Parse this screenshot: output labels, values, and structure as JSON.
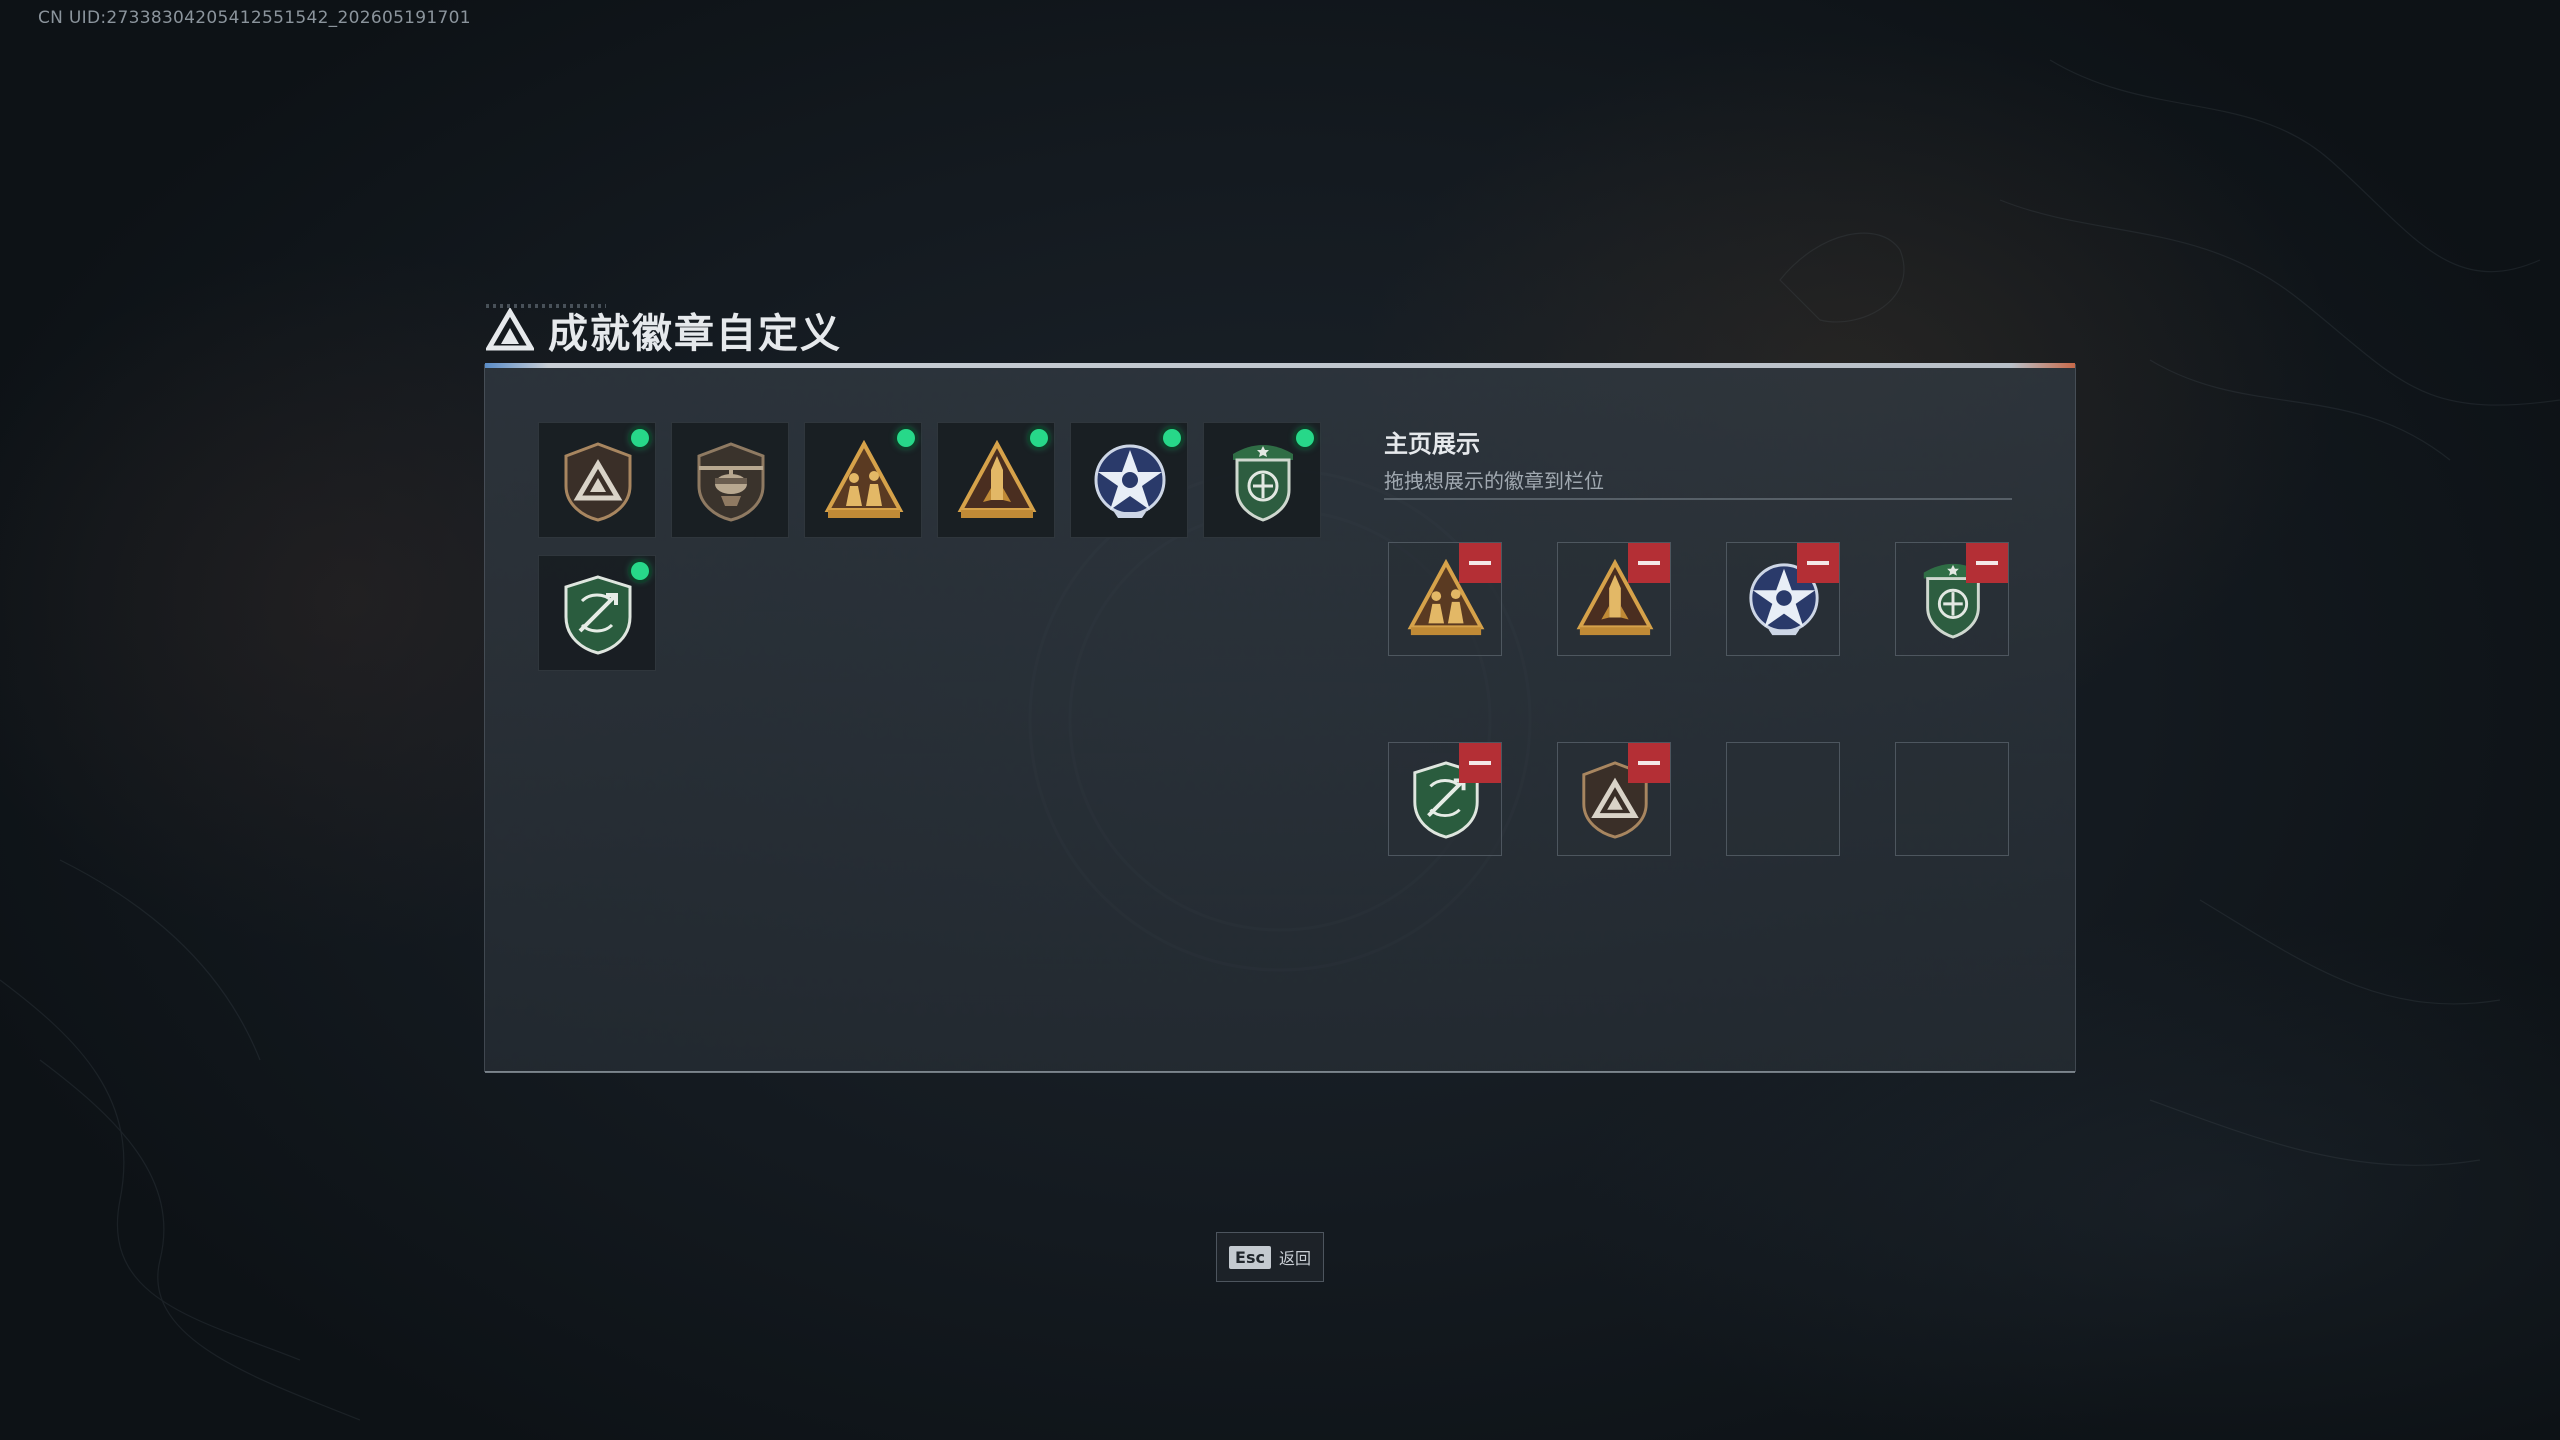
{
  "uid_text": "CN UID:27338304205412551542_202605191701",
  "title": "成就徽章自定义",
  "inventory": [
    {
      "icon": "bronze-shield-triangle-badge-icon",
      "equipped": true
    },
    {
      "icon": "helicopter-shield-badge-icon",
      "equipped": false
    },
    {
      "icon": "gold-soldiers-triangle-badge-icon",
      "equipped": true
    },
    {
      "icon": "gold-rocket-triangle-badge-icon",
      "equipped": true
    },
    {
      "icon": "blue-star-eagle-badge-icon",
      "equipped": true
    },
    {
      "icon": "green-shield-wings-badge-icon",
      "equipped": true
    },
    {
      "icon": "green-crest-arrows-badge-icon",
      "equipped": true
    }
  ],
  "showcase": {
    "title": "主页展示",
    "subtitle": "拖拽想展示的徽章到栏位",
    "slots": [
      {
        "icon": "gold-soldiers-triangle-badge-icon"
      },
      {
        "icon": "gold-rocket-triangle-badge-icon"
      },
      {
        "icon": "blue-star-eagle-badge-icon"
      },
      {
        "icon": "green-shield-wings-badge-icon"
      },
      {
        "icon": "green-crest-arrows-badge-icon"
      },
      {
        "icon": "bronze-shield-triangle-badge-icon"
      },
      {
        "icon": null
      },
      {
        "icon": null
      }
    ]
  },
  "footer": {
    "key": "Esc",
    "label": "返回"
  },
  "colors": {
    "equipped_dot": "#27d889",
    "remove_button": "#b42f35",
    "panel_accent_left": "#5a8cc8",
    "panel_accent_right": "#c86a4a"
  }
}
